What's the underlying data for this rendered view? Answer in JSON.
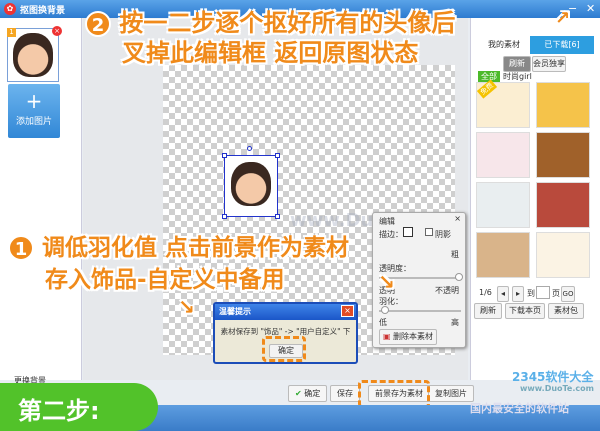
{
  "window": {
    "title": "抠图换背景",
    "minimize": "−",
    "close": "✕"
  },
  "sidebar": {
    "thumb_index": "1",
    "add_label": "添加图片",
    "add_icon": "+",
    "more_bg": "更换背景"
  },
  "right_panel": {
    "tabs": [
      "我的素材",
      "已下载[6]"
    ],
    "subtabs": [
      "刷新",
      "会员独享"
    ],
    "filter_all": "全部",
    "category": "时尚girl",
    "free_badge": "免费",
    "pager": {
      "page": "1/6",
      "goto_label": "到",
      "page_suffix": "页",
      "go": "GO"
    },
    "actions": [
      "刷新",
      "下载本页",
      "素材包"
    ]
  },
  "edit_panel": {
    "title": "编辑",
    "stroke_label": "描边：",
    "shadow_label": "阴影",
    "thick_label": "粗",
    "transparency_label": "透明度：",
    "transparent": "透明",
    "opaque": "不透明",
    "feather_label": "羽化：",
    "low": "低",
    "high": "高",
    "delete_btn": "删除本素材",
    "transparency_value": 1.0,
    "feather_value": 0.05
  },
  "dialog": {
    "title": "温馨提示",
    "message": "素材保存到 \"饰品\" -> \"用户自定义\" 下",
    "ok": "确定"
  },
  "bottom_buttons": [
    "确定",
    "保存",
    "前景存为素材",
    "复制图片"
  ],
  "annotations": {
    "step2_num": "2",
    "step2_line1": "按一二步逐个抠好所有的头像后",
    "step2_line2": "叉掉此编辑框 返回原图状态",
    "step1_num": "1",
    "step1_line1": "调低羽化值 点击前景作为素材",
    "step1_line2": "存入饰品-自定义中备用",
    "step_banner": "第二步:"
  },
  "watermark": {
    "brand": "2345软件大全",
    "url": "www.DuoTe.com",
    "slogan": "国内最安全的软件站",
    "canvas_wm": "www.DuoTe.com"
  }
}
